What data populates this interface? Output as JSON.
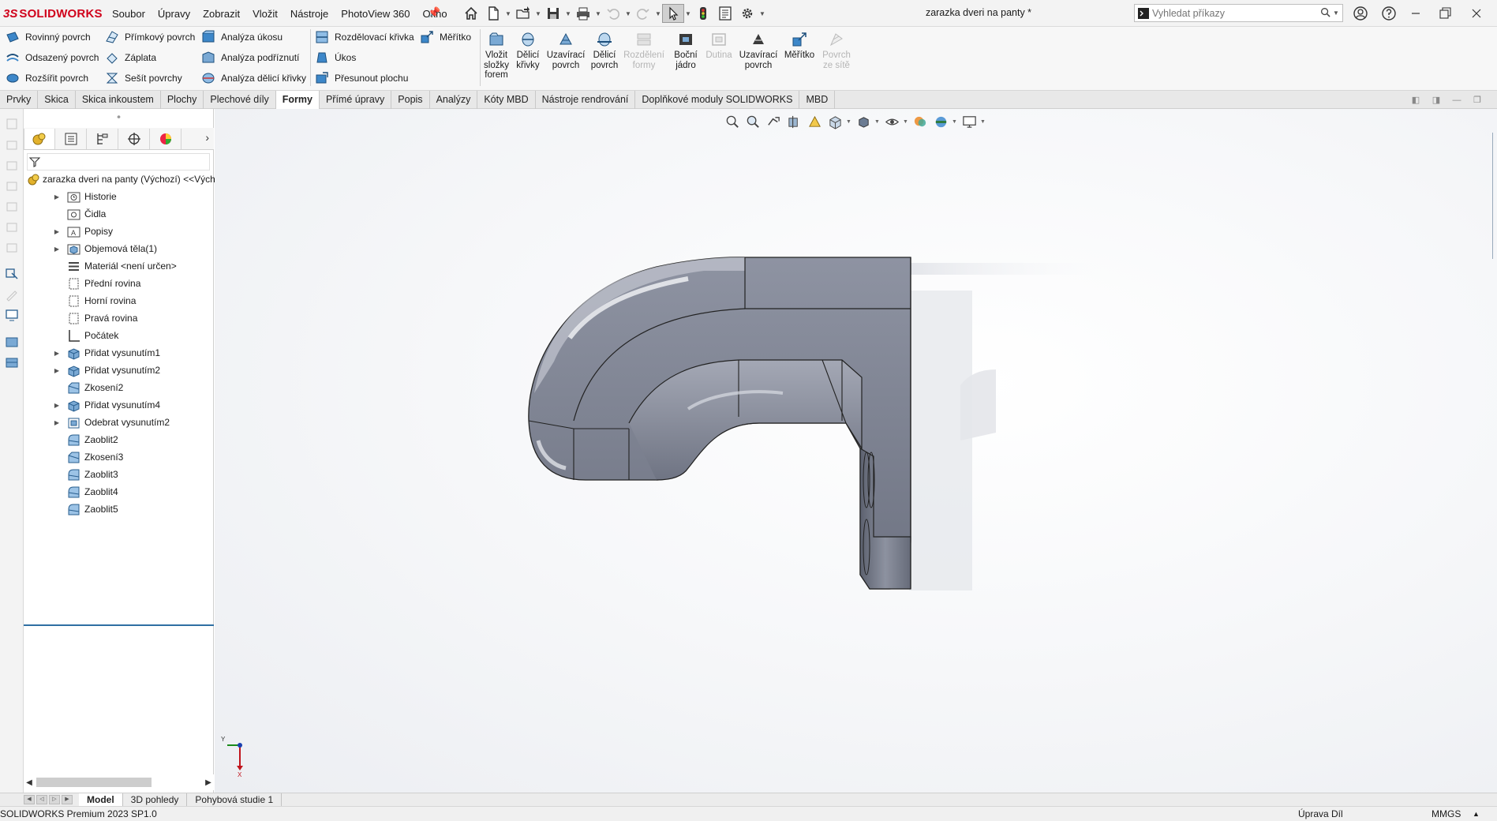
{
  "app": {
    "logo_ds": "3S",
    "logo_text": "SOLIDWORKS",
    "document_title": "zarazka dveri na panty *"
  },
  "menu": [
    "Soubor",
    "Úpravy",
    "Zobrazit",
    "Vložit",
    "Nástroje",
    "PhotoView 360",
    "Okno"
  ],
  "quick_access": [
    "home-icon",
    "new-document-icon",
    "open-folder-icon",
    "save-icon",
    "print-icon",
    "undo-icon",
    "redo-icon",
    "select-arrow-icon",
    "traffic-light-icon",
    "file-properties-icon",
    "options-gear-icon"
  ],
  "search": {
    "placeholder": "Vyhledat příkazy"
  },
  "command_manager": {
    "col1": [
      "Rovinný povrch",
      "Odsazený povrch",
      "Rozšířit povrch"
    ],
    "col2": [
      "Přímkový povrch",
      "Záplata",
      "Sešít povrchy"
    ],
    "col3": [
      "Analýza úkosu",
      "Analýza podříznutí",
      "Analýza dělicí křivky"
    ],
    "col4": [
      "Rozdělovací křivka",
      "Úkos",
      "Přesunout plochu"
    ],
    "col5": [
      "Měřítko"
    ],
    "big_buttons": [
      {
        "label": "Vložit složky forem",
        "enabled": true
      },
      {
        "label": "Dělicí křivky",
        "enabled": true
      },
      {
        "label": "Uzavírací povrch",
        "enabled": true
      },
      {
        "label": "Dělicí povrch",
        "enabled": true
      },
      {
        "label": "Rozdělení formy",
        "enabled": false
      },
      {
        "label": "Boční jádro",
        "enabled": true
      },
      {
        "label": "Dutina",
        "enabled": false
      },
      {
        "label": "Uzavírací povrch",
        "enabled": true
      },
      {
        "label": "Měřítko",
        "enabled": true
      },
      {
        "label": "Povrch ze sítě",
        "enabled": false
      }
    ]
  },
  "tabs": [
    "Prvky",
    "Skica",
    "Skica inkoustem",
    "Plochy",
    "Plechové díly",
    "Formy",
    "Přímé úpravy",
    "Popis",
    "Analýzy",
    "Kóty MBD",
    "Nástroje rendrování",
    "Doplňkové moduly SOLIDWORKS",
    "MBD"
  ],
  "active_tab": "Formy",
  "feature_tree": {
    "root": "zarazka dveri na panty (Výchozí) <<Výchozí>",
    "items": [
      {
        "label": "Historie",
        "expandable": true,
        "icon": "history-folder-icon"
      },
      {
        "label": "Čidla",
        "expandable": false,
        "icon": "sensor-icon"
      },
      {
        "label": "Popisy",
        "expandable": true,
        "icon": "annotations-icon"
      },
      {
        "label": "Objemová těla(1)",
        "expandable": true,
        "icon": "solid-bodies-icon"
      },
      {
        "label": "Materiál <není určen>",
        "expandable": false,
        "icon": "material-icon"
      },
      {
        "label": "Přední rovina",
        "expandable": false,
        "icon": "plane-icon"
      },
      {
        "label": "Horní rovina",
        "expandable": false,
        "icon": "plane-icon"
      },
      {
        "label": "Pravá rovina",
        "expandable": false,
        "icon": "plane-icon"
      },
      {
        "label": "Počátek",
        "expandable": false,
        "icon": "origin-icon"
      },
      {
        "label": "Přidat vysunutím1",
        "expandable": true,
        "icon": "extrude-boss-icon"
      },
      {
        "label": "Přidat vysunutím2",
        "expandable": true,
        "icon": "extrude-boss-icon"
      },
      {
        "label": "Zkosení2",
        "expandable": false,
        "icon": "chamfer-icon"
      },
      {
        "label": "Přidat vysunutím4",
        "expandable": true,
        "icon": "extrude-boss-icon"
      },
      {
        "label": "Odebrat vysunutím2",
        "expandable": true,
        "icon": "extrude-cut-icon"
      },
      {
        "label": "Zaoblit2",
        "expandable": false,
        "icon": "fillet-icon"
      },
      {
        "label": "Zkosení3",
        "expandable": false,
        "icon": "chamfer-icon"
      },
      {
        "label": "Zaoblit3",
        "expandable": false,
        "icon": "fillet-icon"
      },
      {
        "label": "Zaoblit4",
        "expandable": false,
        "icon": "fillet-icon"
      },
      {
        "label": "Zaoblit5",
        "expandable": false,
        "icon": "fillet-icon"
      }
    ]
  },
  "triad": {
    "y_label": "Y",
    "x_label": "X"
  },
  "bottom_tabs": [
    "Model",
    "3D pohledy",
    "Pohybová studie 1"
  ],
  "active_bottom_tab": "Model",
  "status": {
    "version": "SOLIDWORKS Premium 2023 SP1.0",
    "mode": "Úprava Díl",
    "units": "MMGS",
    "units_arrow": "▲"
  },
  "colors": {
    "brand_red": "#d0021b",
    "part_steel": "#7f8391",
    "tree_selection_line": "#2f6fa3"
  }
}
